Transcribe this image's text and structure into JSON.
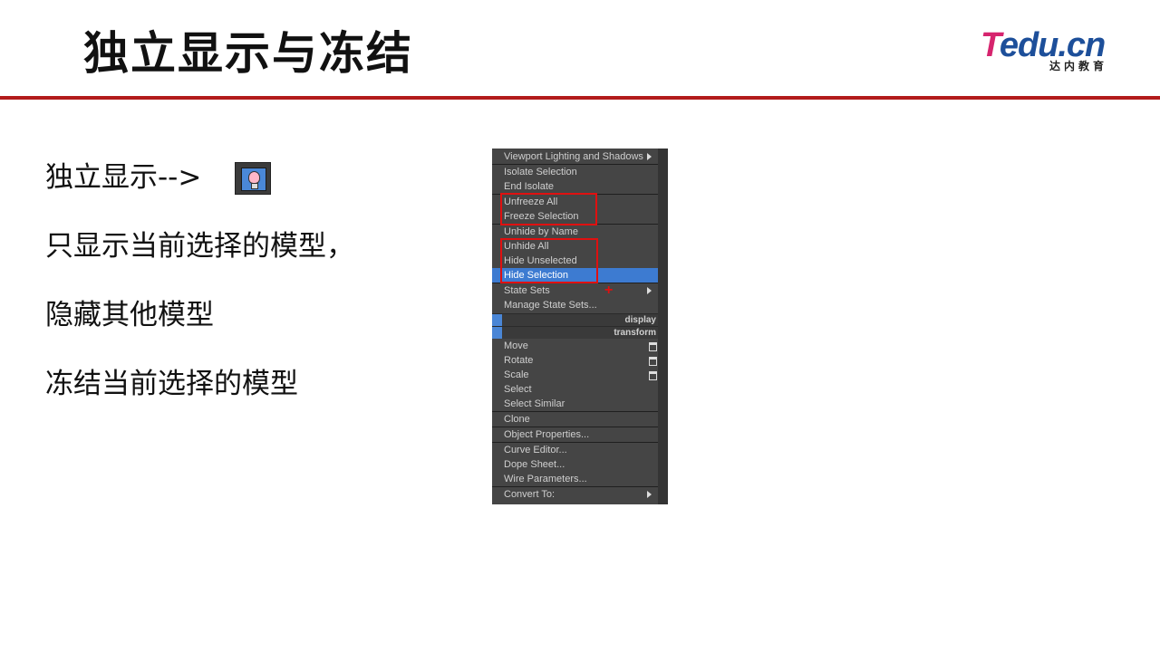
{
  "slide": {
    "title": "独立显示与冻结",
    "logo_main_t": "T",
    "logo_main_rest": "edu.cn",
    "logo_sub": "达内教育",
    "body_lines": [
      "独立显示-->",
      "只显示当前选择的模型，",
      "隐藏其他模型",
      "冻结当前选择的模型"
    ],
    "icon": "isolate-selection-icon"
  },
  "quad_menu": {
    "items": [
      {
        "label": "Viewport Lighting and Shadows",
        "submenu": true
      },
      {
        "label": "Isolate Selection"
      },
      {
        "label": "End Isolate"
      },
      {
        "label": "Unfreeze All"
      },
      {
        "label": "Freeze Selection"
      },
      {
        "label": "Unhide by Name"
      },
      {
        "label": "Unhide All"
      },
      {
        "label": "Hide Unselected"
      },
      {
        "label": "Hide Selection",
        "highlighted": true
      },
      {
        "label": "State Sets",
        "submenu": true
      },
      {
        "label": "Manage State Sets..."
      }
    ],
    "quadrant_labels": [
      "display",
      "transform"
    ],
    "transform_items": [
      {
        "label": "Move",
        "options": true
      },
      {
        "label": "Rotate",
        "options": true
      },
      {
        "label": "Scale",
        "options": true
      },
      {
        "label": "Select"
      },
      {
        "label": "Select Similar"
      },
      {
        "label": "Clone"
      },
      {
        "label": "Object Properties..."
      },
      {
        "label": "Curve Editor..."
      },
      {
        "label": "Dope Sheet..."
      },
      {
        "label": "Wire Parameters..."
      },
      {
        "label": "Convert To:",
        "submenu": true
      }
    ],
    "highlight_color": "#3d7bd1",
    "annotation_color": "#e01010"
  }
}
